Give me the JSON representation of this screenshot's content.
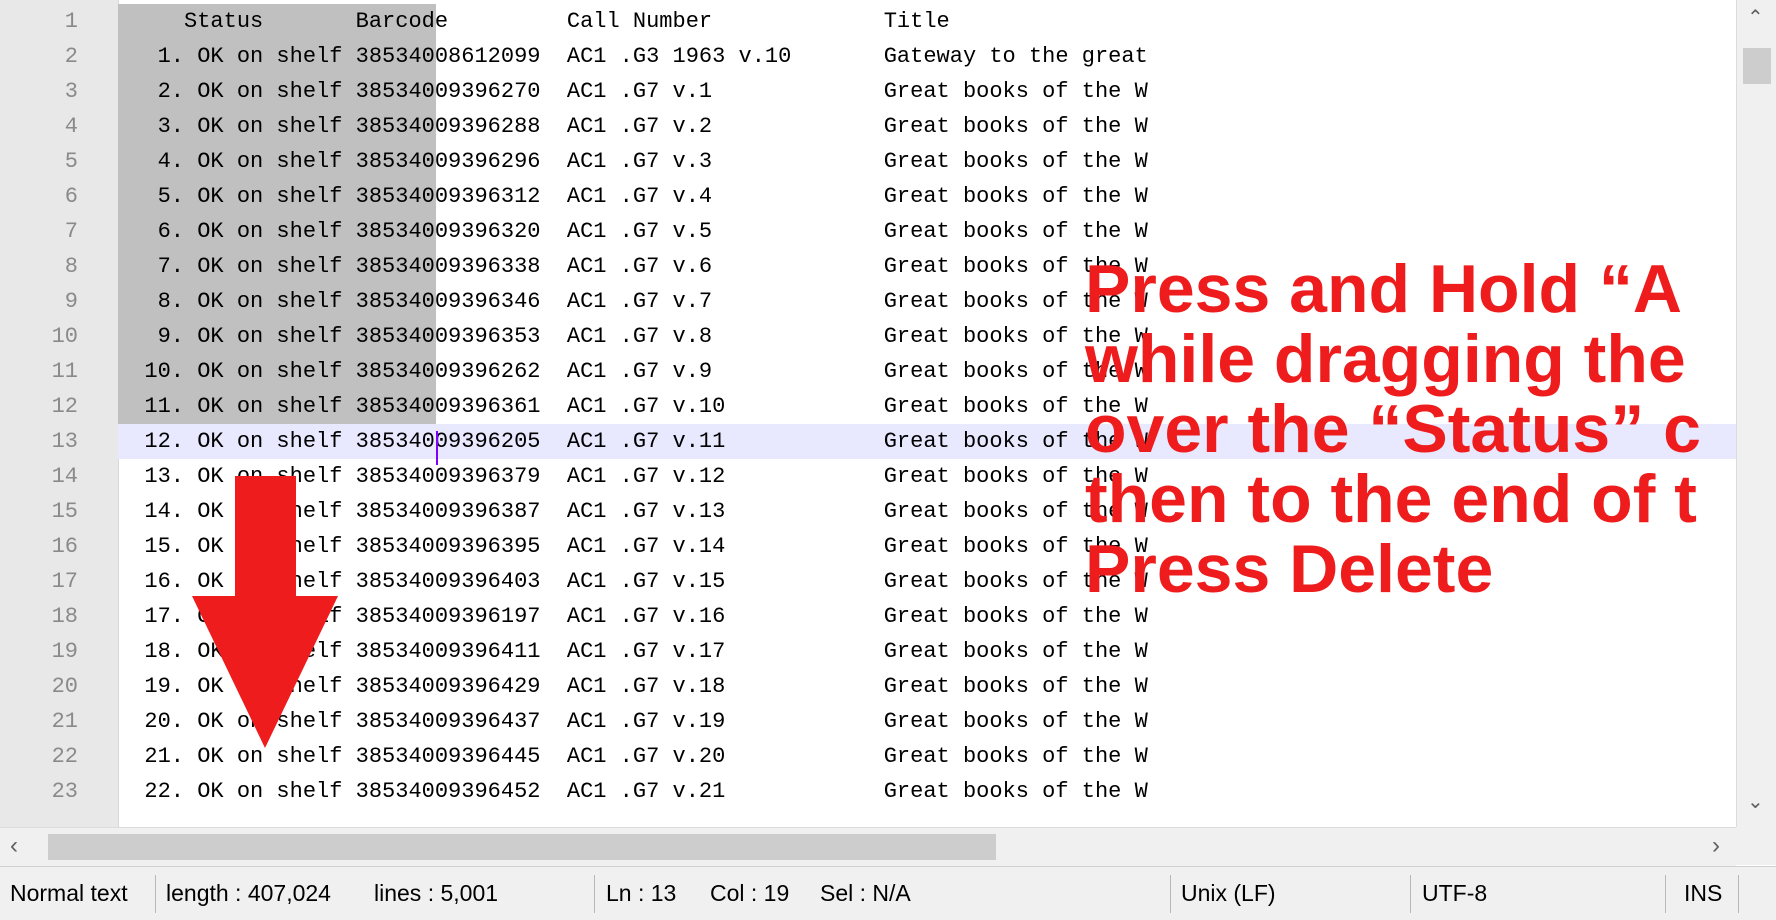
{
  "editor": {
    "line_numbers": [
      "1",
      "2",
      "3",
      "4",
      "5",
      "6",
      "7",
      "8",
      "9",
      "10",
      "11",
      "12",
      "13",
      "14",
      "15",
      "16",
      "17",
      "18",
      "19",
      "20",
      "21",
      "22",
      "23"
    ],
    "lines": [
      "     Status       Barcode         Call Number             Title",
      "   1. OK on shelf 38534008612099  AC1 .G3 1963 v.10       Gateway to the great",
      "   2. OK on shelf 38534009396270  AC1 .G7 v.1             Great books of the W",
      "   3. OK on shelf 38534009396288  AC1 .G7 v.2             Great books of the W",
      "   4. OK on shelf 38534009396296  AC1 .G7 v.3             Great books of the W",
      "   5. OK on shelf 38534009396312  AC1 .G7 v.4             Great books of the W",
      "   6. OK on shelf 38534009396320  AC1 .G7 v.5             Great books of the W",
      "   7. OK on shelf 38534009396338  AC1 .G7 v.6             Great books of the W",
      "   8. OK on shelf 38534009396346  AC1 .G7 v.7             Great books of the W",
      "   9. OK on shelf 38534009396353  AC1 .G7 v.8             Great books of the W",
      "  10. OK on shelf 38534009396262  AC1 .G7 v.9             Great books of the W",
      "  11. OK on shelf 38534009396361  AC1 .G7 v.10            Great books of the W",
      "  12. OK on shelf 38534009396205  AC1 .G7 v.11            Great books of the W",
      "  13. OK on shelf 38534009396379  AC1 .G7 v.12            Great books of the W",
      "  14. OK on shelf 38534009396387  AC1 .G7 v.13            Great books of the W",
      "  15. OK on shelf 38534009396395  AC1 .G7 v.14            Great books of the W",
      "  16. OK on shelf 38534009396403  AC1 .G7 v.15            Great books of the W",
      "  17. OK on shelf 38534009396197  AC1 .G7 v.16            Great books of the W",
      "  18. OK on shelf 38534009396411  AC1 .G7 v.17            Great books of the W",
      "  19. OK on shelf 38534009396429  AC1 .G7 v.18            Great books of the W",
      "  20. OK on shelf 38534009396437  AC1 .G7 v.19            Great books of the W",
      "  21. OK on shelf 38534009396445  AC1 .G7 v.20            Great books of the W",
      "  22. OK on shelf 38534009396452  AC1 .G7 v.21            Great books of the W"
    ],
    "current_line": 13
  },
  "statusbar": {
    "filetype": "Normal text",
    "length": "length : 407,024",
    "lines": "lines : 5,001",
    "ln": "Ln : 13",
    "col": "Col : 19",
    "sel": "Sel : N/A",
    "eol": "Unix (LF)",
    "encoding": "UTF-8",
    "mode": "INS"
  },
  "annotation": {
    "lines": [
      "Press and Hold “A",
      "while dragging the",
      "over the “Status” c",
      "then to the end of t",
      "Press Delete"
    ],
    "color": "#ee1c1c"
  },
  "arrow_color": "#ee1c1c",
  "icons": {
    "up": "up-arrow-icon",
    "down": "down-arrow-icon",
    "left": "left-arrow-icon",
    "right": "right-arrow-icon"
  }
}
